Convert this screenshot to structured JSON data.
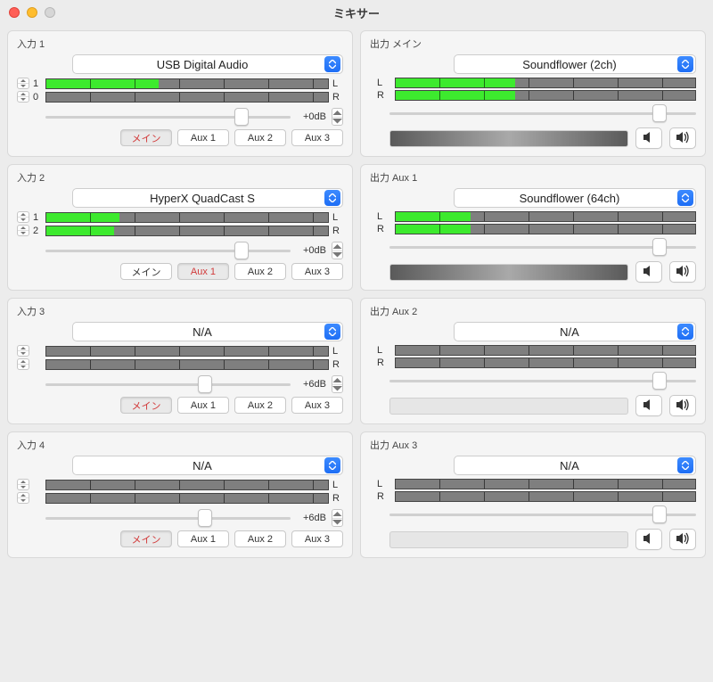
{
  "window": {
    "title": "ミキサー"
  },
  "route_labels": {
    "main": "メイン",
    "aux1": "Aux 1",
    "aux2": "Aux 2",
    "aux3": "Aux 3"
  },
  "inputs": [
    {
      "title": "入力 1",
      "device": "USB Digital Audio",
      "ch": [
        "1",
        "0"
      ],
      "levels": [
        40,
        0
      ],
      "gain": "+0dB",
      "slider": 80,
      "active_route": "main"
    },
    {
      "title": "入力 2",
      "device": "HyperX QuadCast S",
      "ch": [
        "1",
        "2"
      ],
      "levels": [
        26,
        24
      ],
      "gain": "+0dB",
      "slider": 80,
      "active_route": "aux1"
    },
    {
      "title": "入力 3",
      "device": "N/A",
      "ch": [
        "",
        ""
      ],
      "levels": [
        0,
        0
      ],
      "gain": "+6dB",
      "slider": 65,
      "active_route": "main"
    },
    {
      "title": "入力 4",
      "device": "N/A",
      "ch": [
        "",
        ""
      ],
      "levels": [
        0,
        0
      ],
      "gain": "+6dB",
      "slider": 65,
      "active_route": "main"
    }
  ],
  "outputs": [
    {
      "title": "出力 メイン",
      "device": "Soundflower (2ch)",
      "levels": [
        40,
        40
      ],
      "slider": 88,
      "balance_gradient": true
    },
    {
      "title": "出力 Aux 1",
      "device": "Soundflower (64ch)",
      "levels": [
        25,
        25
      ],
      "slider": 88,
      "balance_gradient": true
    },
    {
      "title": "出力 Aux 2",
      "device": "N/A",
      "levels": [
        0,
        0
      ],
      "slider": 88,
      "balance_gradient": false
    },
    {
      "title": "出力 Aux 3",
      "device": "N/A",
      "levels": [
        0,
        0
      ],
      "slider": 88,
      "balance_gradient": false
    }
  ]
}
